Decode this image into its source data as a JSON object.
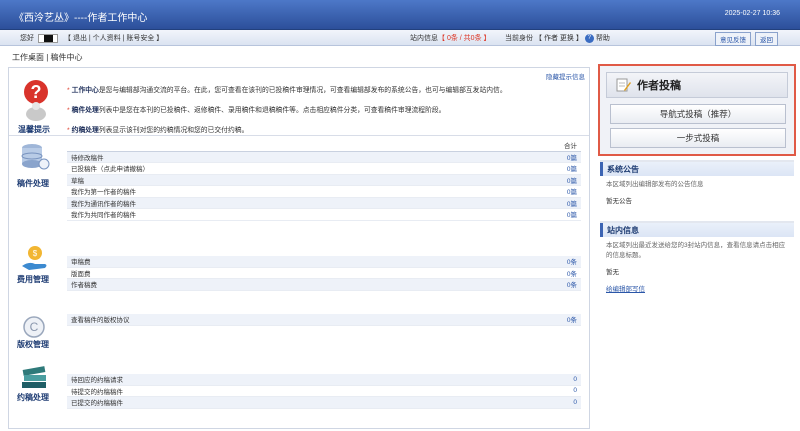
{
  "app": {
    "title": "《西泠艺丛》----作者工作中心",
    "datetime": "2025-02-27 10:36"
  },
  "statusbar": {
    "greeting": "您好",
    "links": "【 退出 | 个人资料 | 账号安全 】",
    "site_msg_label": "站内信息",
    "site_msg_counts": "【 0条 / 共0条 】",
    "role_label": "当前身份",
    "role_value": "【 作者 更换 】",
    "help": "帮助",
    "feedback_button": "意见反馈",
    "home_button": "返回"
  },
  "breadcrumb": "工作桌面 | 稿件中心",
  "main": {
    "hide_tip": "隐藏提示信息",
    "hint": {
      "label": "温馨提示",
      "lines": [
        {
          "bold": "工作中心",
          "text": "是您与编辑部沟通交流的平台。在此，您可查看在该刊的已投稿件审理情况，可查看编辑部发布的系统公告，也可与编辑部互发站内信。"
        },
        {
          "bold": "稿件处理",
          "text": "列表中是您在本刊的已投稿件、返修稿件、录用稿件和退稿稿件等。点击相应稿件分类，可查看稿件审理流程阶段。"
        },
        {
          "bold": "约稿处理",
          "text": "列表显示该刊对您的约稿情况和您的已交付约稿。"
        }
      ]
    },
    "manuscripts": {
      "label": "稿件处理",
      "total_header": "合计",
      "rows": [
        {
          "name": "待修改稿件",
          "value": "0篇"
        },
        {
          "name": "已投稿件（点此申请撤稿）",
          "value": "0篇"
        },
        {
          "name": "草稿",
          "value": "0篇"
        },
        {
          "name": "我作为第一作者的稿件",
          "value": "0篇"
        },
        {
          "name": "我作为通讯作者的稿件",
          "value": "0篇"
        },
        {
          "name": "我作为共同作者的稿件",
          "value": "0篇"
        }
      ]
    },
    "fees": {
      "label": "费用管理",
      "rows": [
        {
          "name": "审稿费",
          "value": "0条"
        },
        {
          "name": "版面费",
          "value": "0条"
        },
        {
          "name": "作者稿费",
          "value": "0条"
        }
      ]
    },
    "copyright": {
      "label": "版权管理",
      "rows": [
        {
          "name": "查看稿件的版权协议",
          "value": "0条"
        }
      ]
    },
    "solicit": {
      "label": "约稿处理",
      "rows": [
        {
          "name": "待回应的约稿请求",
          "value": "0"
        },
        {
          "name": "待提交的约稿稿件",
          "value": "0"
        },
        {
          "name": "已提交的约稿稿件",
          "value": "0"
        }
      ]
    }
  },
  "right": {
    "submit_title": "作者投稿",
    "guided_submit": "导航式投稿（推荐）",
    "one_step_submit": "一步式投稿",
    "announcement": {
      "title": "系统公告",
      "desc": "本区域列出编辑部发布的公告信息",
      "empty": "暂无公告"
    },
    "site_messages": {
      "title": "站内信息",
      "desc": "本区域列出最近发送给您的3封站内信息，查看信息请点击相应的信息标题。",
      "empty": "暂无",
      "link": "给编辑部写信"
    }
  },
  "colors": {
    "titlebar": "#2c4f9a",
    "accent_link": "#2a56a8",
    "highlight_border": "#e05a46",
    "star": "#d32222"
  }
}
